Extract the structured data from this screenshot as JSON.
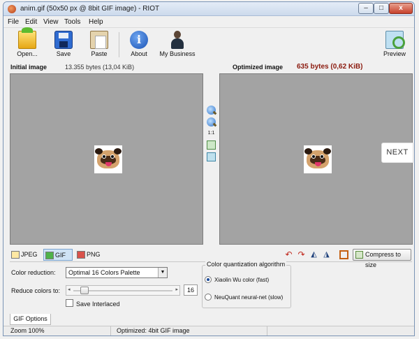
{
  "window": {
    "title": "anim.gif (50x50 px @ 8bit GIF image) - RIOT"
  },
  "menu": [
    "File",
    "Edit",
    "View",
    "Tools",
    "Help"
  ],
  "toolbar": {
    "open": "Open...",
    "save": "Save",
    "paste": "Paste",
    "about": "About",
    "business": "My Business",
    "preview": "Preview"
  },
  "info": {
    "initial_label": "Initial image",
    "initial_size": "13.355 bytes (13,04 KiB)",
    "optimized_label": "Optimized image",
    "optimized_size": "635 bytes (0,62 KiB)",
    "accent_color": "#8b1a0e"
  },
  "zoom": {
    "one_to_one": "1:1"
  },
  "overlay": {
    "next": "NEXT"
  },
  "formats": {
    "jpeg": "JPEG",
    "gif": "GIF",
    "png": "PNG",
    "selected": "GIF"
  },
  "actions": {
    "compress": "Compress to size"
  },
  "options": {
    "color_reduction_label": "Color reduction:",
    "color_reduction_value": "Optimal 16 Colors Palette",
    "reduce_colors_label": "Reduce colors to:",
    "reduce_colors_value": "16",
    "reduce_colors_slider_fraction": 0.06,
    "interlaced_label": "Save Interlaced",
    "interlaced_checked": false,
    "quantization_title": "Color quantization algorithm",
    "quant_option_1": "Xiaolin Wu color (fast)",
    "quant_option_2": "NeuQuant neural-net (slow)",
    "quant_selected": "Xiaolin Wu color (fast)"
  },
  "options_tab": "GIF Options",
  "status": {
    "zoom": "Zoom 100%",
    "message": "Optimized: 4bit GIF image"
  }
}
